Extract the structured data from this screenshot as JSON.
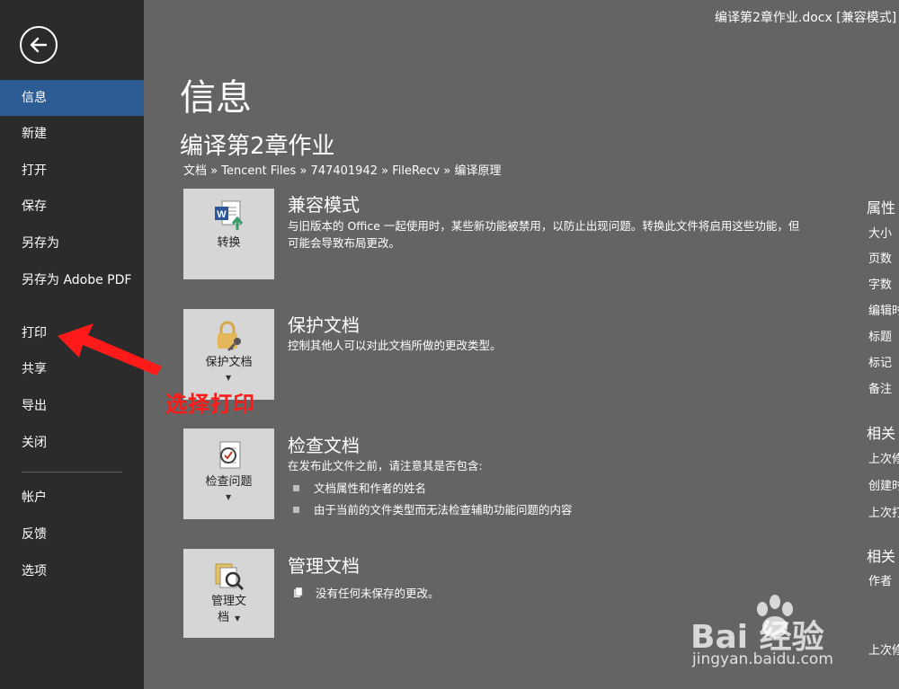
{
  "window": {
    "title": "编译第2章作业.docx [兼容模式]"
  },
  "sidebar": {
    "items": [
      {
        "label": "信息",
        "active": true
      },
      {
        "label": "新建"
      },
      {
        "label": "打开"
      },
      {
        "label": "保存"
      },
      {
        "label": "另存为"
      },
      {
        "label": "另存为 Adobe PDF"
      },
      {
        "label": "打印"
      },
      {
        "label": "共享"
      },
      {
        "label": "导出"
      },
      {
        "label": "关闭"
      }
    ],
    "bottom_items": [
      {
        "label": "帐户"
      },
      {
        "label": "反馈"
      },
      {
        "label": "选项"
      }
    ]
  },
  "main": {
    "page_title": "信息",
    "file_name": "编译第2章作业",
    "breadcrumb": "文档 » Tencent Files » 747401942 » FileRecv » 编译原理",
    "sections": [
      {
        "tile_label": "转换",
        "icon": "word-convert-icon",
        "title": "兼容模式",
        "desc": "与旧版本的 Office 一起使用时，某些新功能被禁用，以防止出现问题。转换此文件将启用这些功能，但可能会导致布局更改。"
      },
      {
        "tile_label": "保护文档",
        "icon": "lock-key-icon",
        "title": "保护文档",
        "desc": "控制其他人可以对此文档所做的更改类型。"
      },
      {
        "tile_label": "检查问题",
        "icon": "inspect-document-icon",
        "title": "检查文档",
        "desc": "在发布此文件之前，请注意其是否包含:",
        "bullets": [
          "文档属性和作者的姓名",
          "由于当前的文件类型而无法检查辅助功能问题的内容"
        ]
      },
      {
        "tile_label": "管理文",
        "tile_label2": "档",
        "icon": "manage-document-icon",
        "title": "管理文档",
        "desc": "没有任何未保存的更改。"
      }
    ]
  },
  "right_panel": {
    "heading1": "属性",
    "props": [
      "大小",
      "页数",
      "字数",
      "编辑时",
      "标题",
      "标记",
      "备注"
    ],
    "heading2": "相关",
    "dates": [
      "上次修",
      "创建时",
      "上次打"
    ],
    "heading3": "相关",
    "people": [
      "作者"
    ],
    "last": "上次修"
  },
  "annotation": {
    "text": "选择打印",
    "color": "#ff1a1a"
  },
  "watermark": {
    "logo": "Bai  经验",
    "url": "jingyan.baidu.com"
  },
  "colors": {
    "sidebar": "#2b2b2b",
    "active": "#2d5b94",
    "background": "#646464",
    "tile": "#d6d6d6"
  }
}
